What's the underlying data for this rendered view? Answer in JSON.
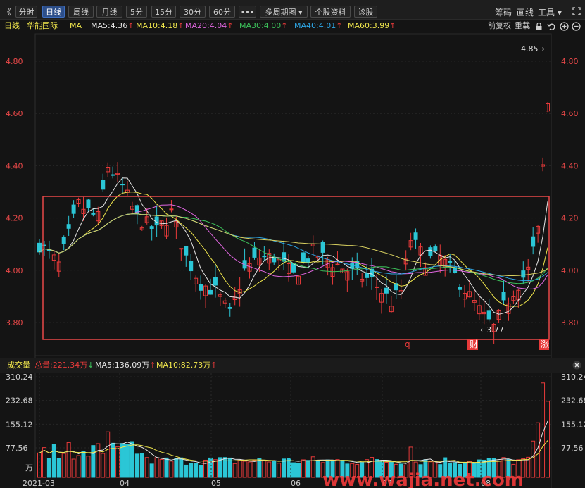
{
  "toolbar": {
    "back": "《",
    "buttons": [
      "分时",
      "日线",
      "周线",
      "月线",
      "5分",
      "15分",
      "30分",
      "60分",
      "•••",
      "多周期图 ▾",
      "个股资料",
      "诊股"
    ],
    "active_index": 1,
    "right_items": [
      "筹码",
      "画线",
      "工具 ▾"
    ]
  },
  "info": {
    "period": "日线",
    "stock_name": "华能国际",
    "ma_label": "MA",
    "ma": [
      {
        "text": "MA5:4.36",
        "arrow": "↑",
        "color": "#e6e6e6"
      },
      {
        "text": "MA10:4.18",
        "arrow": "↑",
        "color": "#f0e64c"
      },
      {
        "text": "MA20:4.04",
        "arrow": "↑",
        "color": "#e066e0"
      },
      {
        "text": "MA30:4.00",
        "arrow": "↑",
        "color": "#3cc05a"
      },
      {
        "text": "MA40:4.01",
        "arrow": "↑",
        "color": "#2ea8e8"
      },
      {
        "text": "MA60:3.99",
        "arrow": "↑",
        "color": "#f0e64c"
      }
    ],
    "right_items": [
      "前复权",
      "重载"
    ]
  },
  "price_axis": {
    "ticks": [
      "4.80",
      "4.60",
      "4.40",
      "4.20",
      "4.00",
      "3.80"
    ],
    "values": [
      4.8,
      4.6,
      4.4,
      4.2,
      4.0,
      3.8
    ],
    "min": 3.7,
    "max": 4.9
  },
  "annotations": {
    "high": "4.85→",
    "low": "←3.77",
    "markers": [
      {
        "text": "q",
        "filled": false
      },
      {
        "text": "财",
        "filled": true
      },
      {
        "text": "涨",
        "filled": true
      }
    ]
  },
  "volume": {
    "label": "成交量",
    "total": "总量:221.34万",
    "total_arrow": "↓",
    "ma5": "MA5:136.09万",
    "ma5_arrow": "↑",
    "ma10": "MA10:82.73万",
    "ma10_arrow": "↑",
    "ticks": [
      "310.24",
      "232.68",
      "155.12",
      "77.56"
    ],
    "tick_values": [
      310.24,
      232.68,
      155.12,
      77.56
    ],
    "unit": "万"
  },
  "date_axis": [
    "2021-03",
    "04",
    "05",
    "06",
    "07",
    "08"
  ],
  "watermark": "www.wajia.net.com",
  "colors": {
    "up": "#e83a3a",
    "down": "#2bc6d6",
    "frame": "#e84848",
    "axis": "#e84848"
  }
}
